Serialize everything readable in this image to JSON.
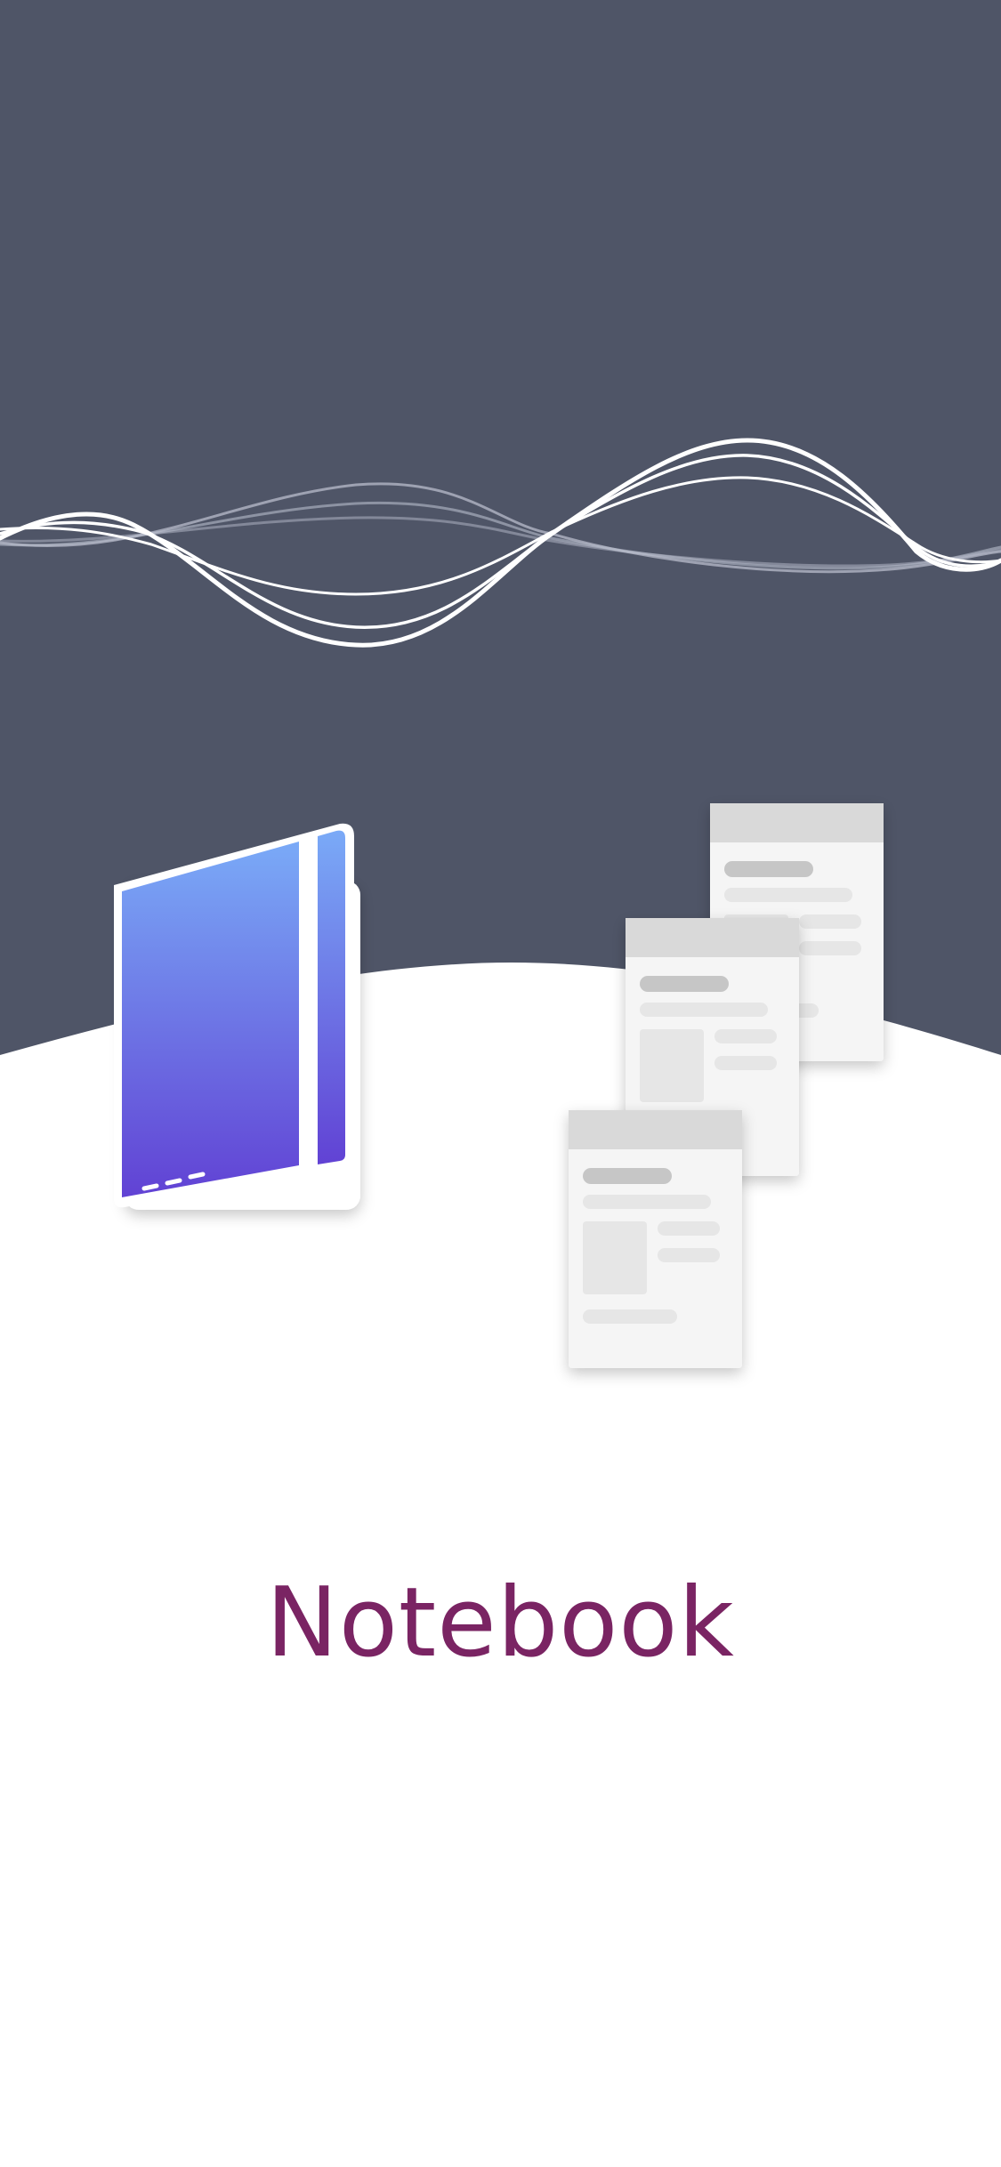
{
  "title": "Notebook",
  "colors": {
    "background_top": "#4f5567",
    "background_bottom": "#ffffff",
    "title": "#7a2463",
    "notebook_gradient_top": "#78a8f6",
    "notebook_gradient_bottom": "#6142d4",
    "page_header": "#d9d9d9",
    "page_body": "#f5f5f5"
  },
  "icons": {
    "wave": "sound-wave-icon",
    "notebook": "notebook-icon",
    "pages": "page-card-icon"
  }
}
